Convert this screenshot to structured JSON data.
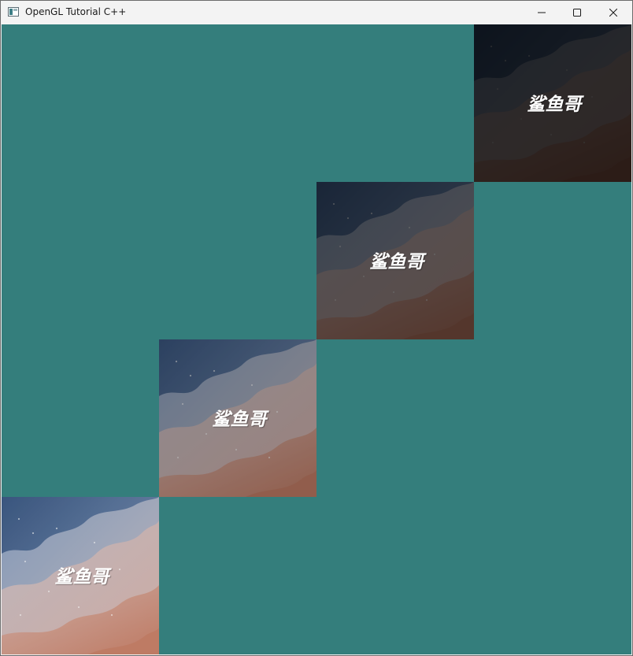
{
  "window": {
    "title": "OpenGL Tutorial C++",
    "icon": "app-window-icon",
    "controls": [
      "minimize-icon",
      "maximize-icon",
      "close-icon"
    ]
  },
  "scene": {
    "clear_color": "#347e7c",
    "texture_caption": "鲨鱼哥",
    "texture_colors": {
      "sky_dark": "#3d5a85",
      "sky_mid": "#8aa1c1",
      "mid_band": "#c8bfc5",
      "lower_band": "#d8b5ad",
      "bottom": "#c9826a"
    },
    "quads": [
      {
        "id": "quad-1",
        "brightness": 0.22,
        "caption": "鲨鱼哥"
      },
      {
        "id": "quad-2",
        "brightness": 0.42,
        "caption": "鲨鱼哥"
      },
      {
        "id": "quad-3",
        "brightness": 0.72,
        "caption": "鲨鱼哥"
      },
      {
        "id": "quad-4",
        "brightness": 0.95,
        "caption": "鲨鱼哥"
      }
    ]
  }
}
